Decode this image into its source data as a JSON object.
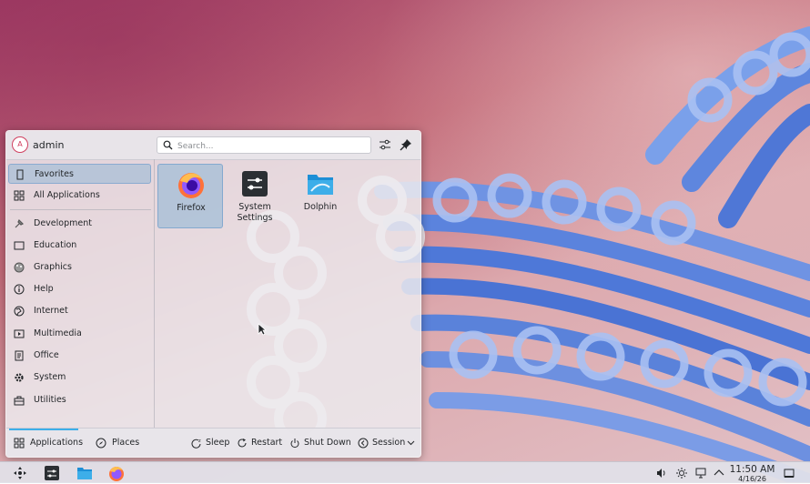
{
  "user": {
    "name": "admin",
    "avatar_letter": "A"
  },
  "search": {
    "placeholder": "Search...",
    "value": ""
  },
  "header_icons": [
    "configure-icon",
    "pin-icon"
  ],
  "sidebar": {
    "items": [
      {
        "label": "Favorites",
        "icon": "bookmark-icon",
        "selected": true
      },
      {
        "label": "All Applications",
        "icon": "grid-icon"
      },
      {
        "label": "Development",
        "icon": "development-icon"
      },
      {
        "label": "Education",
        "icon": "education-icon"
      },
      {
        "label": "Graphics",
        "icon": "graphics-icon"
      },
      {
        "label": "Help",
        "icon": "help-icon"
      },
      {
        "label": "Internet",
        "icon": "internet-icon"
      },
      {
        "label": "Multimedia",
        "icon": "multimedia-icon"
      },
      {
        "label": "Office",
        "icon": "office-icon"
      },
      {
        "label": "System",
        "icon": "system-icon"
      },
      {
        "label": "Utilities",
        "icon": "utilities-icon"
      }
    ]
  },
  "favorites": [
    {
      "label": "Firefox",
      "icon": "firefox-icon",
      "selected": true
    },
    {
      "label": "System Settings",
      "icon": "system-settings-icon"
    },
    {
      "label": "Dolphin",
      "icon": "dolphin-icon"
    }
  ],
  "footer": {
    "tabs": [
      {
        "label": "Applications",
        "icon": "applications-icon",
        "active": true
      },
      {
        "label": "Places",
        "icon": "places-icon"
      }
    ],
    "actions": [
      {
        "label": "Sleep",
        "icon": "sleep-icon"
      },
      {
        "label": "Restart",
        "icon": "restart-icon"
      },
      {
        "label": "Shut Down",
        "icon": "shutdown-icon"
      },
      {
        "label": "Session",
        "icon": "session-icon"
      }
    ]
  },
  "taskbar": {
    "launchers": [
      "application-launcher-icon",
      "system-settings-icon",
      "dolphin-icon",
      "firefox-icon"
    ],
    "tray": [
      "volume-icon",
      "brightness-icon",
      "network-icon",
      "expand-tray-icon"
    ],
    "clock": {
      "time": "11:50 AM",
      "date": "4/16/26"
    }
  },
  "colors": {
    "accent": "#3daee9",
    "selection": "#93b8d6",
    "avatar": "#d04060"
  }
}
